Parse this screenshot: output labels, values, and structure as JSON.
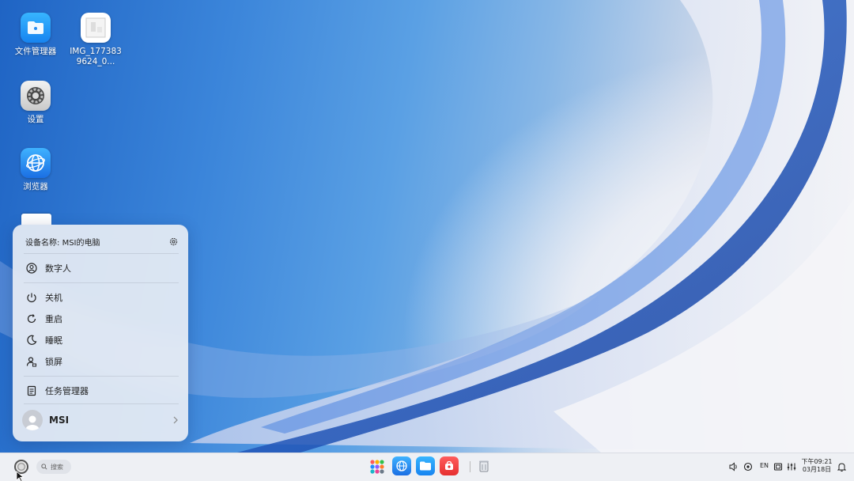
{
  "desktop": {
    "icons": [
      {
        "name": "file-manager",
        "label": "文件管理器"
      },
      {
        "name": "image-file",
        "label": "IMG_1773839624_0..."
      },
      {
        "name": "settings",
        "label": "设置"
      },
      {
        "name": "browser",
        "label": "浏览器"
      }
    ]
  },
  "start_menu": {
    "device_label": "设备名称:",
    "device_name": "MSI的电脑",
    "items": [
      {
        "label": "数字人",
        "icon": "digital-human-icon"
      },
      {
        "label": "关机",
        "icon": "power-icon"
      },
      {
        "label": "重启",
        "icon": "restart-icon"
      },
      {
        "label": "睡眠",
        "icon": "sleep-icon"
      },
      {
        "label": "锁屏",
        "icon": "lock-icon"
      },
      {
        "label": "任务管理器",
        "icon": "task-manager-icon"
      }
    ],
    "user_name": "MSI"
  },
  "taskbar": {
    "search_placeholder": "搜索",
    "pinned_apps": [
      "app-launcher-icon",
      "browser-icon",
      "file-manager-icon",
      "app-store-icon",
      "trash-icon"
    ],
    "tray": {
      "language": "EN",
      "time": "下午09:21",
      "date": "03月18日"
    }
  },
  "colors": {
    "accent": "#1f7cf0",
    "taskbar_bg": "#eef0f4",
    "menu_bg": "#eceff5"
  }
}
